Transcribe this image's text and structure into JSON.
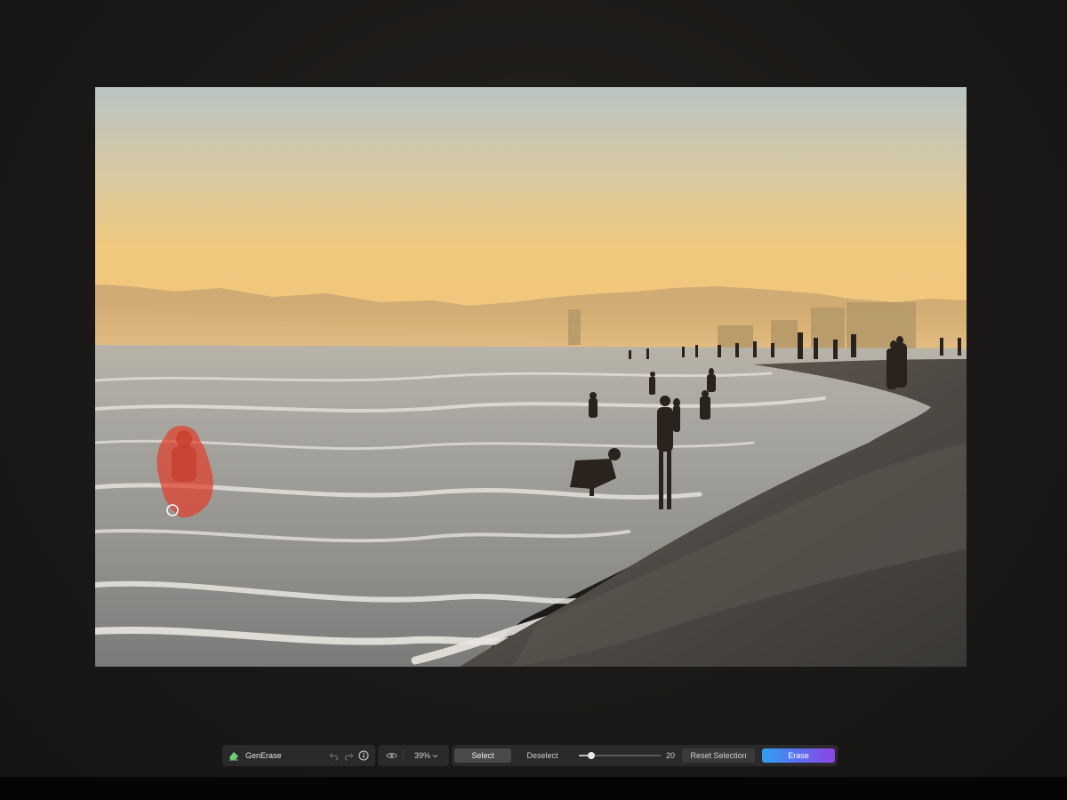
{
  "toolbar": {
    "tool_name": "GenErase",
    "zoom_level": "39%",
    "select_label": "Select",
    "deselect_label": "Deselect",
    "brush_size": "20",
    "reset_selection_label": "Reset Selection",
    "erase_label": "Erase"
  },
  "icons": {
    "tool": "eraser-icon",
    "undo": "undo-icon",
    "redo": "redo-icon",
    "info": "info-icon",
    "preview": "eye-icon",
    "zoom_menu": "chevron-down-icon"
  },
  "colors": {
    "accent_start": "#2fa0f0",
    "accent_end": "#8e44e6",
    "tool_icon": "#6fd07a",
    "selection_mask": "#e0402c"
  }
}
